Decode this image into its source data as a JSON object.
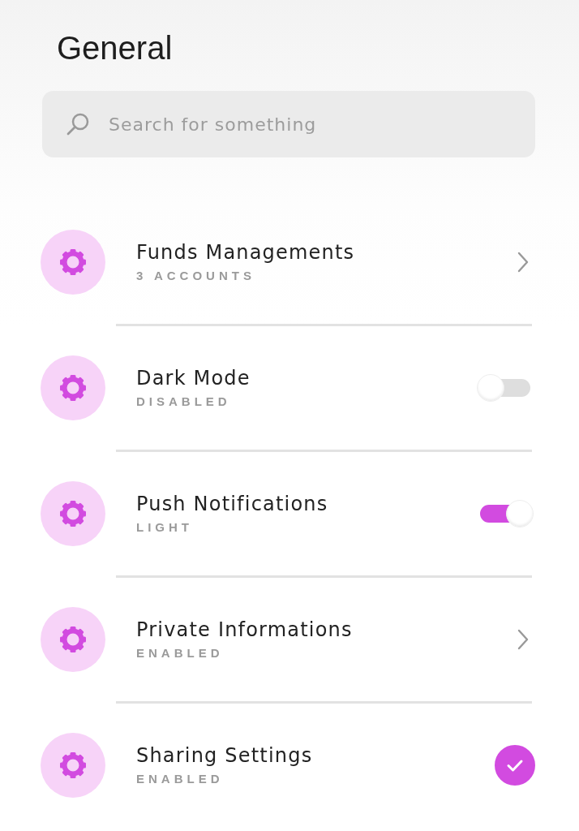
{
  "title": "General",
  "search": {
    "placeholder": "Search for something"
  },
  "items": [
    {
      "kind": "link",
      "title": "Funds Managements",
      "subtitle": "3 ACCOUNTS"
    },
    {
      "kind": "toggle",
      "title": "Dark Mode",
      "subtitle": "DISABLED",
      "on": false
    },
    {
      "kind": "toggle",
      "title": "Push Notifications",
      "subtitle": "LIGHT",
      "on": true
    },
    {
      "kind": "link",
      "title": "Private Informations",
      "subtitle": "ENABLED"
    },
    {
      "kind": "check",
      "title": "Sharing Settings",
      "subtitle": "ENABLED",
      "checked": true
    }
  ]
}
